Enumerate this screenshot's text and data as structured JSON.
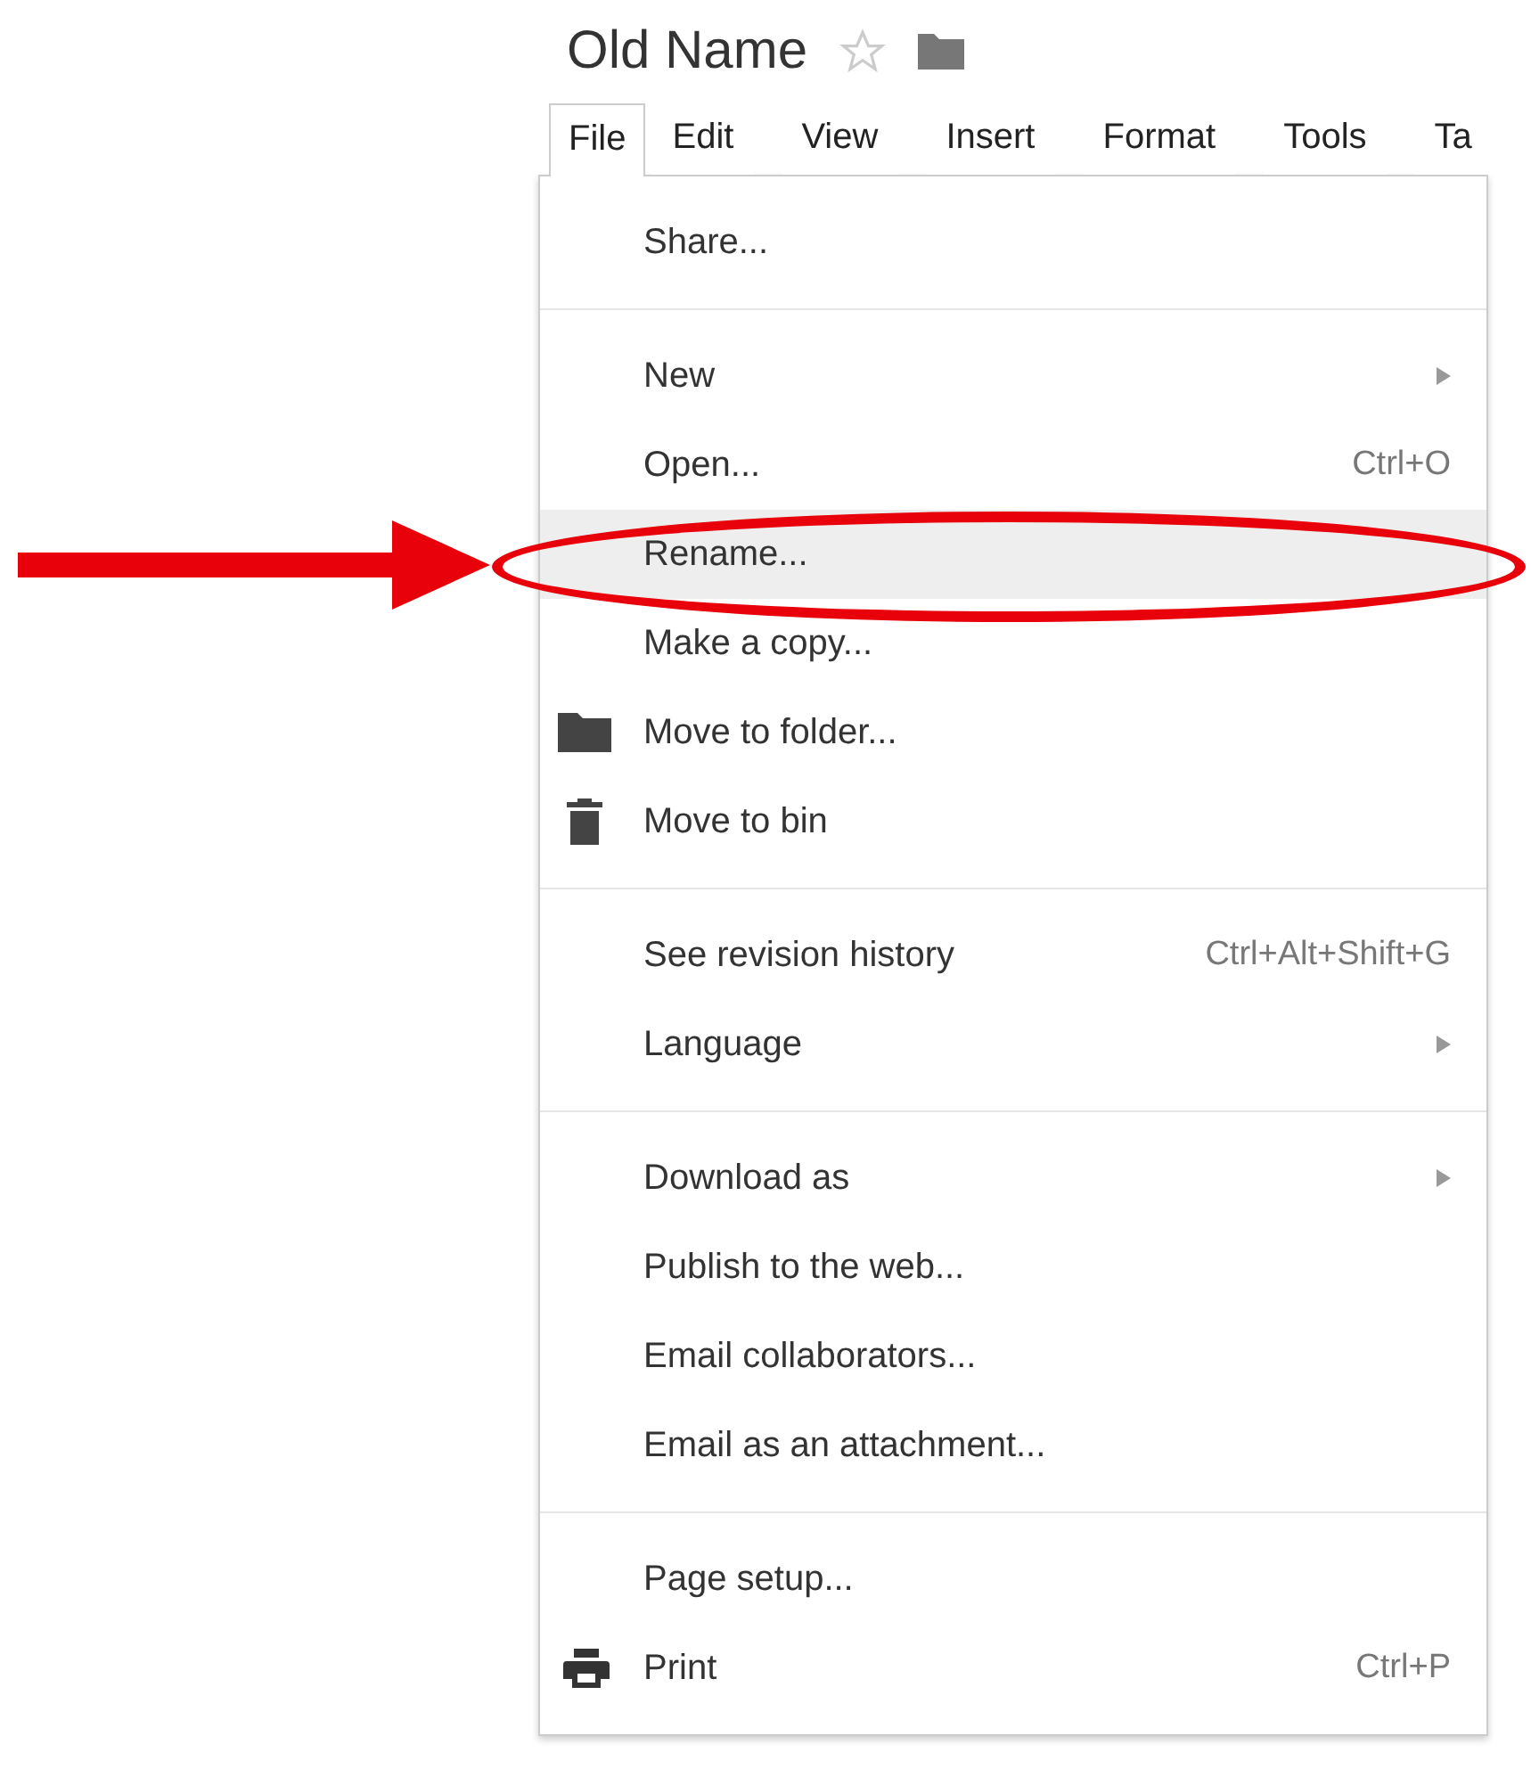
{
  "document": {
    "title": "Old Name",
    "starred": false
  },
  "menu_bar": [
    {
      "label": "File",
      "selected": true
    },
    {
      "label": "Edit",
      "selected": false
    },
    {
      "label": "View",
      "selected": false
    },
    {
      "label": "Insert",
      "selected": false
    },
    {
      "label": "Format",
      "selected": false
    },
    {
      "label": "Tools",
      "selected": false
    },
    {
      "label": "Ta",
      "selected": false
    }
  ],
  "file_menu": {
    "sections": [
      {
        "items": [
          {
            "label": "Share...",
            "selected": false
          }
        ]
      },
      {
        "items": [
          {
            "label": "New",
            "submenu": true,
            "selected": false
          },
          {
            "label": "Open...",
            "shortcut": "Ctrl+O",
            "selected": false
          },
          {
            "label": "Rename...",
            "selected": true
          },
          {
            "label": "Make a copy...",
            "selected": false
          },
          {
            "label": "Move to folder...",
            "kind": "folder",
            "selected": false
          },
          {
            "label": "Move to bin",
            "kind": "bin",
            "selected": false
          }
        ]
      },
      {
        "items": [
          {
            "label": "See revision history",
            "shortcut": "Ctrl+Alt+Shift+G",
            "selected": false
          },
          {
            "label": "Language",
            "submenu": true,
            "selected": false
          }
        ]
      },
      {
        "items": [
          {
            "label": "Download as",
            "submenu": true,
            "selected": false
          },
          {
            "label": "Publish to the web...",
            "selected": false
          },
          {
            "label": "Email collaborators...",
            "selected": false
          },
          {
            "label": "Email as an attachment...",
            "selected": false
          }
        ]
      },
      {
        "items": [
          {
            "label": "Page setup...",
            "selected": false
          },
          {
            "label": "Print",
            "kind": "print",
            "shortcut": "Ctrl+P",
            "selected": false
          }
        ]
      }
    ]
  }
}
